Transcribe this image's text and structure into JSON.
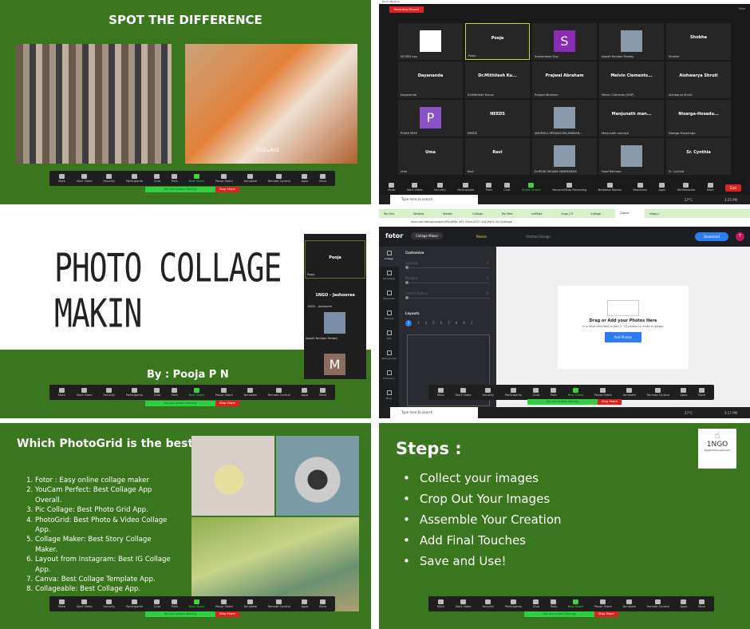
{
  "zoom_toolbar": [
    "Mute",
    "Start Video",
    "Security",
    "Participants",
    "Chat",
    "Polls",
    "New Share",
    "Pause Share",
    "Annotate",
    "Remote Control",
    "Apps",
    "More"
  ],
  "sharing": {
    "status": "You are screen sharing",
    "stop": "Stop Share"
  },
  "slide1": {
    "title": "SPOT THE DIFFERENCE",
    "collage_caption": "COLLAGE"
  },
  "meeting": {
    "window_title": "Zoom Meeting",
    "recording": "Recording Paused",
    "view": "View",
    "tiles": [
      {
        "name": "",
        "label": "ISCERD ngo",
        "avatar": "logo"
      },
      {
        "name": "Pooja",
        "label": "Pooja",
        "active": true
      },
      {
        "name": "",
        "label": "Subramania Siva",
        "avatar": "S",
        "color": "#8a2bb8"
      },
      {
        "name": "",
        "label": "Awadh Nandan Pandey",
        "avatar": "photo"
      },
      {
        "name": "Shobha",
        "label": "Shobha"
      },
      {
        "name": "Dayananda",
        "label": "Dayananda"
      },
      {
        "name": "Dr.Mithilesh  Ku...",
        "label": "Dr.Mithilesh Kumar"
      },
      {
        "name": "Prajwal Abraham",
        "label": "Prajwal Abraham"
      },
      {
        "name": "Melvin  Clements...",
        "label": "Melvin Clements (ODP)"
      },
      {
        "name": "Aishwarya Shruti",
        "label": "Aishwarya Shruti"
      },
      {
        "name": "",
        "label": "PHANI SREE",
        "avatar": "P",
        "color": "#8e52c8"
      },
      {
        "name": "NEEDS",
        "label": "NEEDS"
      },
      {
        "name": "",
        "label": "ANUMULA,PEDDAGORA,NIDMAN...",
        "avatar": "photo"
      },
      {
        "name": "Manjunath  man...",
        "label": "Manjunath mandya"
      },
      {
        "name": "Nisarga-Hosadu...",
        "label": "Nisarga-Hosadurga"
      },
      {
        "name": "Uma",
        "label": "Uma"
      },
      {
        "name": "Ravi",
        "label": "Ravi"
      },
      {
        "name": "",
        "label": "Dr.READ SELVAM ANDIMADAM",
        "avatar": "photo"
      },
      {
        "name": "",
        "label": "Fazal Rehman",
        "avatar": "photo"
      },
      {
        "name": "Sr. Cynthia",
        "label": "Sr. Cynthia"
      }
    ],
    "toolbar": [
      "Mute",
      "Start Video",
      "Security",
      "Participants",
      "Polls",
      "Chat",
      "Share Screen",
      "Resume/Stop Recording",
      "Breakout Rooms",
      "Reactions",
      "Apps",
      "Whiteboards",
      "More"
    ],
    "participants_count": "20",
    "end": "End",
    "taskbar": {
      "search": "Type here to search",
      "weather": "27°C",
      "time": "3:25 PM"
    }
  },
  "slide3": {
    "title": "PHOTO COLLAGE MAKIN",
    "byline": "By : Pooja P N",
    "side_tiles": [
      {
        "name": "Pooja",
        "label": "Pooja"
      },
      {
        "name": "1NGO - Jashooree",
        "label": "1NGO - Jashooree"
      },
      {
        "name": "",
        "label": "Awadh Nandan Pandey"
      },
      {
        "name": "M",
        "label": ""
      }
    ]
  },
  "fotor": {
    "tabs": [
      "My Driv",
      "WhatsA",
      "Master",
      "Collage",
      "My Mee",
      "us08we",
      "1ngo | H",
      "Collage",
      "Classic",
      "https://"
    ],
    "url": "fotor.com/design/project/ff1d8f5e-0ff1-41a4-a527-4d12fa01c0c7/collage",
    "logo": "fotor",
    "mode": "Collage Maker",
    "resize": "Resize",
    "doc_title": "Untitled Design",
    "download": "Download",
    "avatar": "T",
    "sidebar": [
      "Collage",
      "Templates",
      "Elements",
      "Uploads",
      "Text",
      "Background",
      "Extension",
      "More"
    ],
    "customize": "Customize",
    "sliders": [
      {
        "label": "Spacing",
        "value": "0"
      },
      {
        "label": "Margins",
        "value": "0"
      },
      {
        "label": "Corner Radius",
        "value": "0"
      }
    ],
    "layouts": "Layouts",
    "layout_numbers": [
      "2",
      "3",
      "4",
      "5",
      "6",
      "7",
      "8",
      "9",
      "1"
    ],
    "drop_title": "Drag or Add your Photos Here",
    "drop_sub": "It is recommended to add 2~12 photos to make a collage",
    "add_photos": "Add Photos",
    "taskbar": {
      "search": "Type here to search",
      "weather": "27°C",
      "time": "3:17 PM"
    }
  },
  "slide5": {
    "title": "Which PhotoGrid is the best?",
    "items": [
      "Fotor : Easy online collage maker",
      "YouCam Perfect: Best Collage App Overall.",
      "Pic Collage: Best Photo Grid App.",
      "PhotoGrid: Best Photo & Video Collage App.",
      "Collage Maker: Best Story Collage Maker.",
      "Layout from Instagram: Best IG Collage App.",
      "Canva: Best Collage Template App.",
      "Collageable: Best Collage App."
    ]
  },
  "slide6": {
    "title": "Steps :",
    "steps": [
      "Collect your images",
      "Crop Out Your Images",
      "Assemble Your Creation",
      "Add Final Touches",
      "Save and Use!"
    ],
    "logo_text": "1NGO",
    "logo_sub": "Digital Empowerment"
  },
  "colors": {
    "slide_green": "#3a761e",
    "zoom_dark": "#1a1a1a",
    "fotor_blue": "#2d7cf6",
    "stop_red": "#e02020",
    "share_green": "#2fcf3f"
  }
}
